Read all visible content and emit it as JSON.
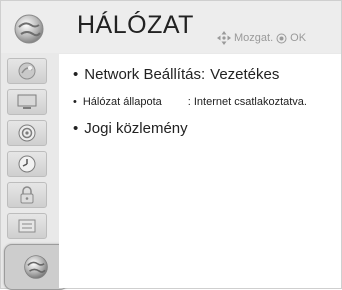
{
  "header": {
    "title": "HÁLÓZAT",
    "icon": "network-globe-icon",
    "hint_move": "Mozgat.",
    "hint_ok": "OK"
  },
  "sidebar": {
    "items": [
      {
        "icon": "picture-icon"
      },
      {
        "icon": "display-icon"
      },
      {
        "icon": "audio-icon"
      },
      {
        "icon": "clock-icon"
      },
      {
        "icon": "lock-icon"
      },
      {
        "icon": "options-icon"
      },
      {
        "icon": "network-icon",
        "active": true
      }
    ]
  },
  "menu": {
    "network_settings": {
      "bullet": "•",
      "label": "Network Beállítás:",
      "value": "Vezetékes"
    },
    "network_status": {
      "bullet": "•",
      "label": "Hálózat állapota",
      "value": ": Internet csatlakoztatva."
    },
    "legal": {
      "bullet": "•",
      "label": "Jogi közlemény"
    }
  }
}
